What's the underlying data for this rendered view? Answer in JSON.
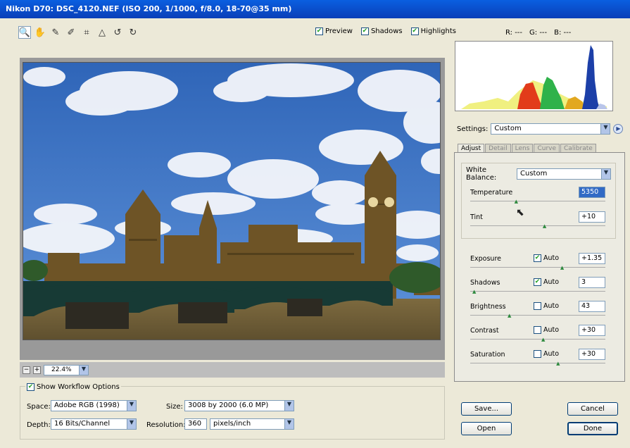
{
  "window": {
    "title": "Nikon D70: DSC_4120.NEF  (ISO 200, 1/1000, f/8.0, 18-70@35 mm)"
  },
  "tools": [
    {
      "name": "zoom-tool-icon",
      "glyph": "🔍"
    },
    {
      "name": "hand-tool-icon",
      "glyph": "✋"
    },
    {
      "name": "white-balance-tool-icon",
      "glyph": "✎"
    },
    {
      "name": "color-sampler-tool-icon",
      "glyph": "✐"
    },
    {
      "name": "crop-tool-icon",
      "glyph": "⌗"
    },
    {
      "name": "straighten-tool-icon",
      "glyph": "△"
    },
    {
      "name": "rotate-left-icon",
      "glyph": "↺"
    },
    {
      "name": "rotate-right-icon",
      "glyph": "↻"
    }
  ],
  "options": {
    "preview": "Preview",
    "shadows": "Shadows",
    "highlights": "Highlights"
  },
  "readout": {
    "r": "R: ---",
    "g": "G: ---",
    "b": "B: ---"
  },
  "zoom": {
    "value": "22.4%",
    "minus": "−",
    "plus": "+"
  },
  "settings": {
    "label": "Settings:",
    "value": "Custom"
  },
  "tabs": [
    "Adjust",
    "Detail",
    "Lens",
    "Curve",
    "Calibrate"
  ],
  "white_balance": {
    "label": "White Balance:",
    "value": "Custom"
  },
  "sliders": [
    {
      "label": "Temperature",
      "value": "5350",
      "level": 0.34,
      "highlighted": true
    },
    {
      "label": "Tint",
      "value": "+10",
      "level": 0.55
    }
  ],
  "adjust_sliders": [
    {
      "label": "Exposure",
      "auto": true,
      "value": "+1.35",
      "level": 0.68
    },
    {
      "label": "Shadows",
      "auto": true,
      "value": "3",
      "level": 0.03
    },
    {
      "label": "Brightness",
      "auto": false,
      "value": "43",
      "level": 0.29
    },
    {
      "label": "Contrast",
      "auto": false,
      "value": "+30",
      "level": 0.54
    },
    {
      "label": "Saturation",
      "auto": false,
      "value": "+30",
      "level": 0.65
    }
  ],
  "auto_label": "Auto",
  "workflow": {
    "show_label": "Show Workflow Options",
    "space_label": "Space:",
    "space_value": "Adobe RGB (1998)",
    "depth_label": "Depth:",
    "depth_value": "16 Bits/Channel",
    "size_label": "Size:",
    "size_value": "3008 by 2000 (6.0 MP)",
    "resolution_label": "Resolution:",
    "resolution_value": "360",
    "resolution_unit": "pixels/inch"
  },
  "buttons": {
    "save": "Save...",
    "open": "Open",
    "cancel": "Cancel",
    "done": "Done"
  },
  "colors": {
    "accent": "#316ac5",
    "title_bar": "#0a4fd0",
    "sky": "#3d78c9",
    "stone": "#8a6a38"
  }
}
